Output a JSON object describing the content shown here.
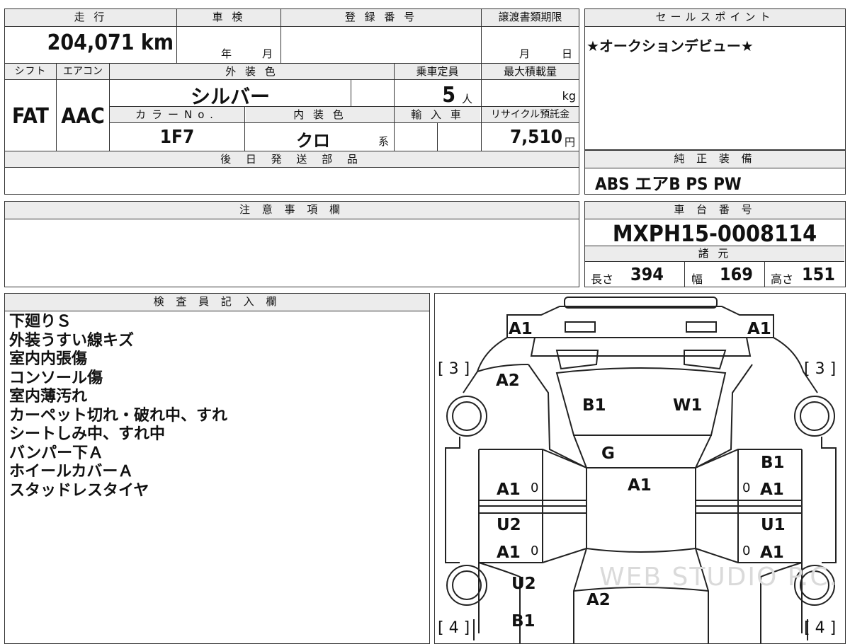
{
  "top_row": {
    "odometer_label": "走 行",
    "odometer_value": "204,071 km",
    "inspection_label": "車 検",
    "inspection_year_unit": "年",
    "inspection_month_unit": "月",
    "registration_label": "登 録 番 号",
    "transfer_label": "譲渡書類期限",
    "transfer_month_unit": "月",
    "transfer_day_unit": "日"
  },
  "sales_point": {
    "label": "セールスポイント",
    "text": "★オークションデビュー★"
  },
  "specs": {
    "shift_label": "シフト",
    "shift_value": "FAT",
    "aircon_label": "エアコン",
    "aircon_value": "AAC",
    "exterior_label": "外 装 色",
    "exterior_value": "シルバー",
    "capacity_label": "乗車定員",
    "capacity_value": "5",
    "capacity_unit": "人",
    "max_load_label": "最大積載量",
    "max_load_unit": "kg",
    "color_no_label": "カラーNo.",
    "color_no_value": "1F7",
    "interior_label": "内 装 色",
    "interior_value": "クロ",
    "interior_suffix": "系",
    "import_label": "輸 入 車",
    "recycle_label": "リサイクル預託金",
    "recycle_value": "7,510",
    "recycle_unit": "円"
  },
  "later_parts": {
    "label": "後 日 発 送 部 品",
    "text": ""
  },
  "genuine_equipment": {
    "label": "純 正 装 備",
    "text": "ABS エアB PS PW"
  },
  "notes": {
    "label": "注 意 事 項 欄",
    "text": ""
  },
  "chassis": {
    "label": "車 台 番 号",
    "value": "MXPH15-0008114"
  },
  "dimensions": {
    "label": "諸 元",
    "length_label": "長さ",
    "length_value": "394",
    "width_label": "幅",
    "width_value": "169",
    "height_label": "高さ",
    "height_value": "151"
  },
  "inspector": {
    "label": "検 査 員 記 入 欄",
    "lines": [
      "下廻りＳ",
      "外装うすい線キズ",
      "室内内張傷",
      "コンソール傷",
      "室内薄汚れ",
      "カーペット切れ・破れ中、すれ",
      "シートしみ中、すれ中",
      "バンパー下Ａ",
      "ホイールカバーＡ",
      "スタッドレスタイヤ"
    ]
  },
  "diagram": {
    "watermark": "WEB STUDIO P.C.",
    "tire_front_left": "[ 3 ]",
    "tire_front_right": "[ 3 ]",
    "tire_rear_left": "[ 4 ]",
    "tire_rear_right": "[ 4 ]",
    "marks": {
      "front_bumper_left": "A1",
      "front_bumper_right": "A1",
      "fender_front_left": "A2",
      "hood_left": "B1",
      "hood_right": "W1",
      "windshield": "G",
      "roof": "A1",
      "front_door_left": "A1",
      "front_door_right_top": "B1",
      "front_door_right": "A1",
      "rear_door_left_top": "U2",
      "rear_door_left": "A1",
      "rear_door_right_top": "U1",
      "rear_door_right": "A1",
      "rear_fender_left": "U2",
      "rear_glass": "A2",
      "rear_bumper_left": "B1",
      "zero_mark": "0"
    }
  }
}
